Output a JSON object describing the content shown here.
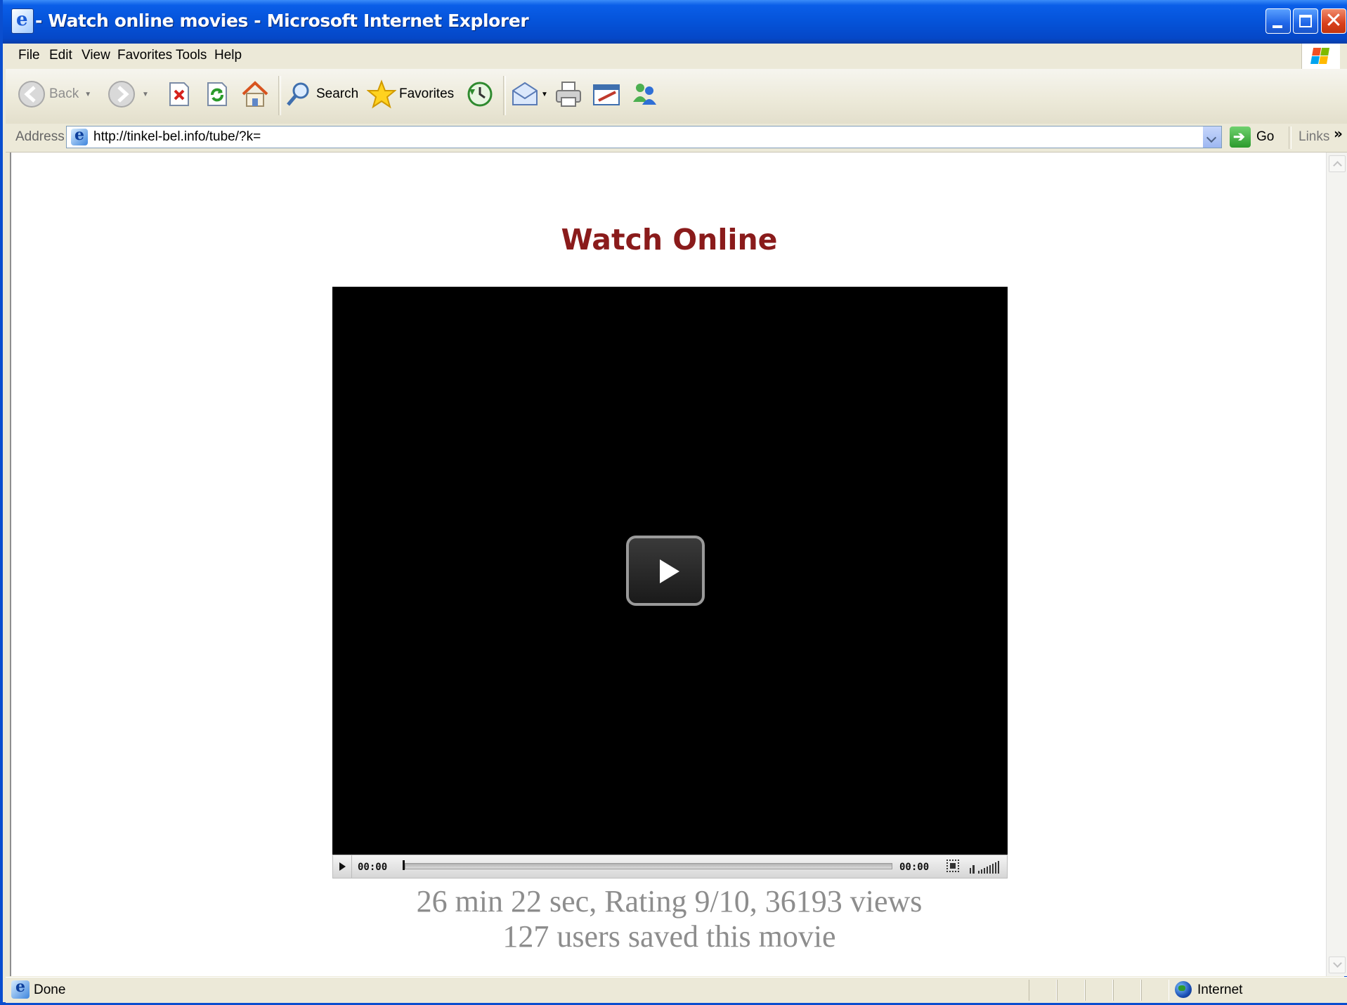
{
  "window": {
    "title": "- Watch online movies - Microsoft Internet Explorer"
  },
  "menu": [
    "File",
    "Edit",
    "View",
    "Favorites",
    "Tools",
    "Help"
  ],
  "toolbar": {
    "back_label": "Back",
    "search_label": "Search",
    "favorites_label": "Favorites"
  },
  "address": {
    "label": "Address",
    "url": "http://tinkel-bel.info/tube/?k=",
    "go_label": "Go",
    "links_label": "Links",
    "links_chevron": "»"
  },
  "page": {
    "heading": "Watch Online",
    "player": {
      "current_time": "00:00",
      "total_time": "00:00",
      "progress": 0
    },
    "info_line_1": "26 min 22 sec, Rating 9/10, 36193 views",
    "info_line_2": "127 users saved this movie"
  },
  "status": {
    "text": "Done",
    "zone": "Internet"
  },
  "colors": {
    "title_bar": "#0553d9",
    "heading": "#8a1b1b",
    "info_text": "#8d8d8d"
  },
  "icons": [
    "ie-page-icon",
    "back-arrow-icon",
    "forward-arrow-icon",
    "stop-icon",
    "refresh-icon",
    "home-icon",
    "search-magnifier-icon",
    "favorites-star-icon",
    "history-icon",
    "mail-icon",
    "print-icon",
    "edit-icon",
    "messenger-icon",
    "go-arrow-icon",
    "internet-globe-icon",
    "windows-flag-icon"
  ]
}
